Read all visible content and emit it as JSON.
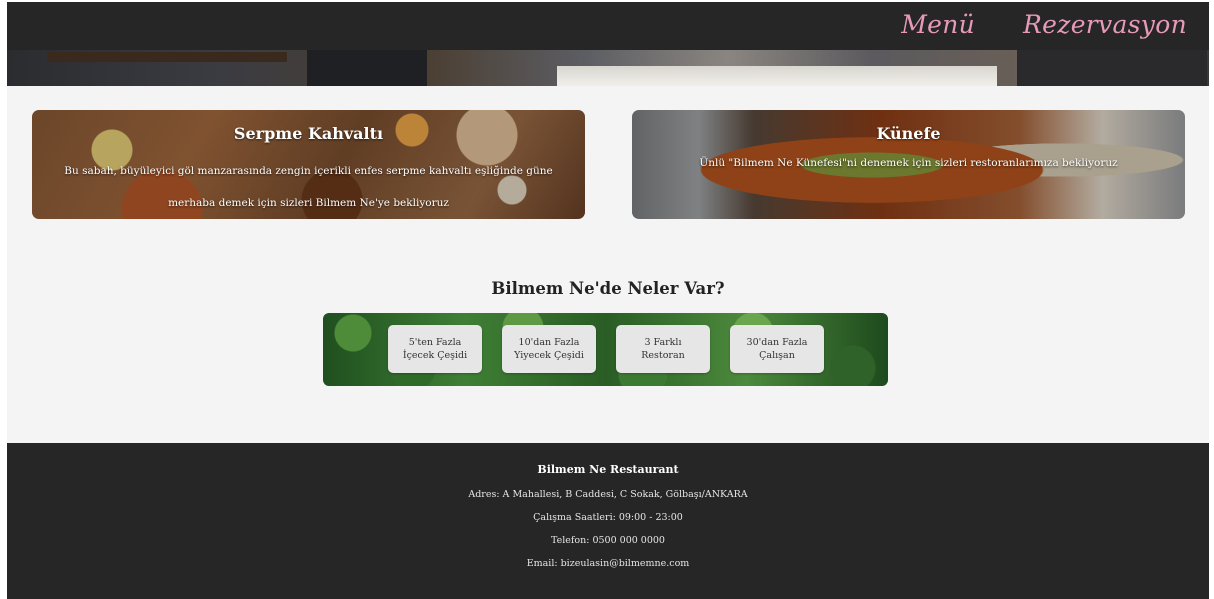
{
  "nav": {
    "items": [
      "Menü",
      "Rezervasyon"
    ],
    "color": "#e79ab8"
  },
  "cards": [
    {
      "title": "Serpme Kahvaltı",
      "text": "Bu sabah, büyüleyici göl manzarasında zengin içerikli enfes serpme kahvaltı eşliğinde güne merhaba demek için sizleri Bilmem Ne'ye bekliyoruz"
    },
    {
      "title": "Künefe",
      "text": "Ünlü \"Bilmem Ne Künefesi\"ni denemek için sizleri restoranlarımıza bekliyoruz"
    }
  ],
  "section": {
    "title": "Bilmem Ne'de Neler Var?",
    "stats": [
      {
        "line1": "5'ten Fazla",
        "line2": "İçecek Çeşidi"
      },
      {
        "line1": "10'dan Fazla",
        "line2": "Yiyecek Çeşidi"
      },
      {
        "line1": "3 Farklı",
        "line2": "Restoran"
      },
      {
        "line1": "30'dan Fazla",
        "line2": "Çalışan"
      }
    ]
  },
  "footer": {
    "name": "Bilmem Ne Restaurant",
    "address": "Adres: A Mahallesi, B Caddesi, C Sokak, Gölbaşı/ANKARA",
    "hours": "Çalışma Saatleri: 09:00 - 23:00",
    "phone": "Telefon: 0500 000 0000",
    "email": "Email: bizeulasin@bilmemne.com"
  }
}
